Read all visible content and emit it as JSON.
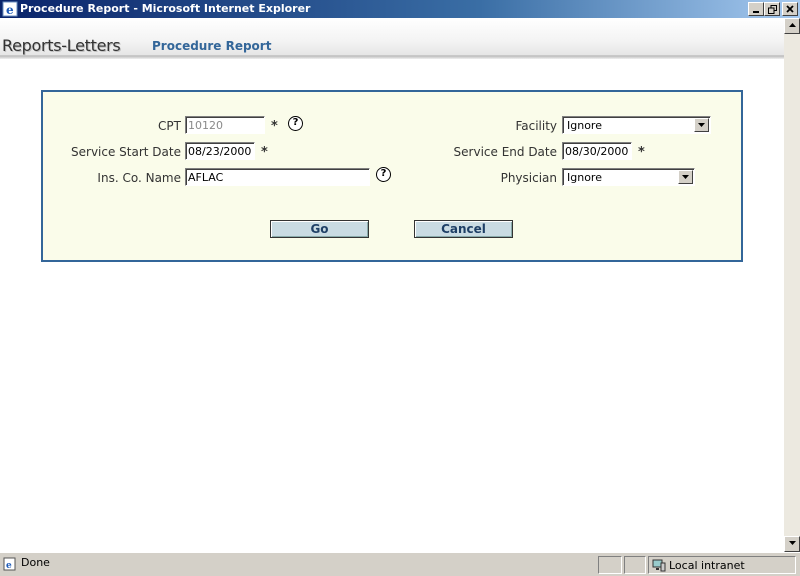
{
  "window": {
    "title": "Procedure Report - Microsoft Internet Explorer",
    "icon": "ie-icon",
    "controls": [
      "minimize-icon",
      "restore-icon",
      "close-icon"
    ]
  },
  "header": {
    "brand": "Reports-Letters",
    "page_title": "Procedure Report"
  },
  "form": {
    "cpt": {
      "label": "CPT",
      "value": "10120",
      "required_marker": "*",
      "help": "?"
    },
    "facility": {
      "label": "Facility",
      "selected": "Ignore"
    },
    "service_start": {
      "label": "Service Start Date",
      "value": "08/23/2000",
      "required_marker": "*"
    },
    "service_end": {
      "label": "Service End Date",
      "value": "08/30/2000",
      "required_marker": "*"
    },
    "ins_co": {
      "label": "Ins. Co. Name",
      "value": "AFLAC",
      "help": "?"
    },
    "physician": {
      "label": "Physician",
      "selected": "Ignore"
    },
    "buttons": {
      "go": "Go",
      "cancel": "Cancel"
    }
  },
  "status": {
    "text": "Done",
    "zone": "Local intranet"
  },
  "colors": {
    "panel_bg": "#fafcea",
    "panel_border": "#336699",
    "accent_text": "#336699",
    "button_bg": "#c9dbe3"
  }
}
